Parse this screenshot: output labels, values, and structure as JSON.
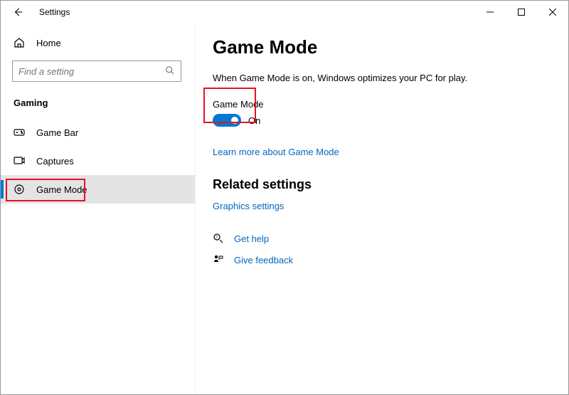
{
  "app_title": "Settings",
  "nav": {
    "home_label": "Home",
    "search_placeholder": "Find a setting",
    "category": "Gaming",
    "items": [
      {
        "label": "Game Bar"
      },
      {
        "label": "Captures"
      },
      {
        "label": "Game Mode"
      }
    ]
  },
  "page": {
    "title": "Game Mode",
    "description": "When Game Mode is on, Windows optimizes your PC for play.",
    "toggle_label": "Game Mode",
    "toggle_state": "On",
    "learn_more": "Learn more about Game Mode",
    "related_header": "Related settings",
    "graphics_link": "Graphics settings",
    "get_help": "Get help",
    "give_feedback": "Give feedback"
  }
}
